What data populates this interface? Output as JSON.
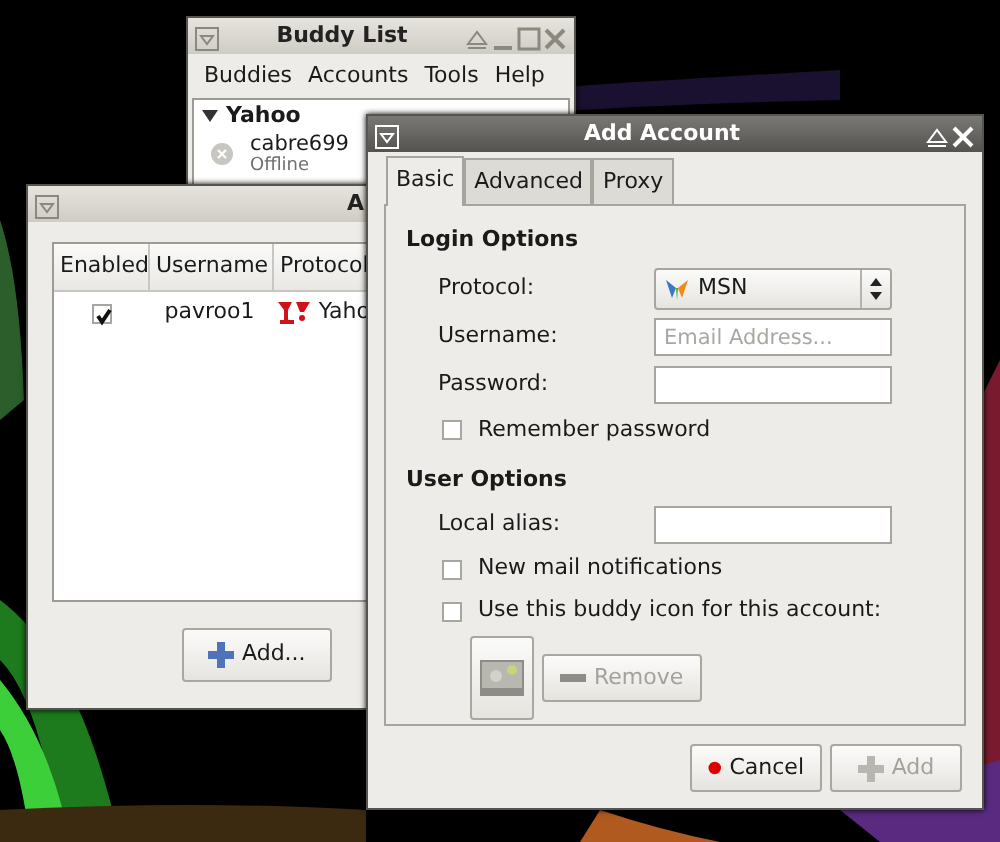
{
  "buddy_list": {
    "title": "Buddy List",
    "active": false,
    "menu": [
      "Buddies",
      "Accounts",
      "Tools",
      "Help"
    ],
    "groups": [
      {
        "name": "Yahoo",
        "expanded": true,
        "buddies": [
          {
            "name": "cabre699",
            "status": "Offline"
          }
        ]
      }
    ]
  },
  "accounts_window": {
    "title": "A",
    "active": false,
    "table": {
      "columns": [
        "Enabled",
        "Username",
        "Protocol"
      ],
      "rows": [
        {
          "enabled": true,
          "username": "pavroo1",
          "protocol": "Yaho"
        }
      ]
    },
    "buttons": [
      {
        "label": "Add...",
        "disabled": false
      }
    ]
  },
  "add_account": {
    "title": "Add Account",
    "active": true,
    "tabs": [
      {
        "label": "Basic",
        "selected": true
      },
      {
        "label": "Advanced",
        "selected": false
      },
      {
        "label": "Proxy",
        "selected": false
      }
    ],
    "login_options": {
      "heading": "Login Options",
      "protocol": {
        "label": "Protocol:",
        "value": "MSN"
      },
      "username": {
        "label": "Username:",
        "placeholder": "Email Address..."
      },
      "password": {
        "label": "Password:"
      },
      "remember_password": {
        "label": "Remember password",
        "checked": false
      }
    },
    "user_options": {
      "heading": "User Options",
      "local_alias": {
        "label": "Local alias:"
      },
      "new_mail": {
        "label": "New mail notifications",
        "checked": false
      },
      "buddy_icon": {
        "label": "Use this buddy icon for this account:",
        "checked": false
      },
      "remove_button": {
        "label": "Remove",
        "disabled": true
      }
    },
    "buttons": [
      {
        "label": "Cancel",
        "kind": "cancel",
        "disabled": false
      },
      {
        "label": "Add",
        "kind": "add",
        "disabled": true
      }
    ]
  }
}
